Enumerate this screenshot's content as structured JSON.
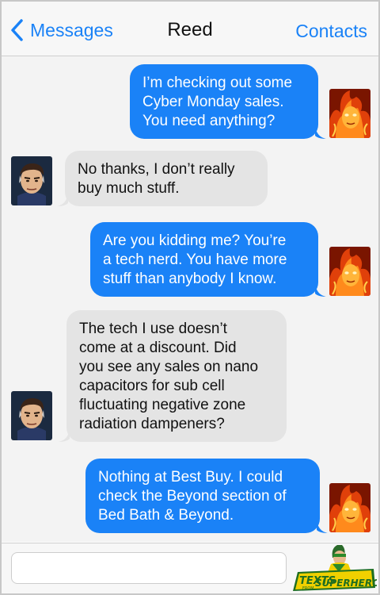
{
  "nav": {
    "back_label": "Messages",
    "title": "Reed",
    "right_label": "Contacts"
  },
  "messages": [
    {
      "sender": "me",
      "lines": [
        "I’m checking out some",
        "Cyber Monday sales.",
        "You need anything?"
      ]
    },
    {
      "sender": "Reed",
      "lines": [
        "No thanks, I don’t really",
        "buy much stuff."
      ]
    },
    {
      "sender": "me",
      "lines": [
        "Are you kidding me? You’re",
        "a tech nerd. You have more",
        "stuff than anybody I know."
      ]
    },
    {
      "sender": "Reed",
      "lines": [
        "The tech I use doesn’t",
        "come at a discount. Did",
        "you see any sales on nano",
        "capacitors for sub cell",
        "fluctuating negative zone",
        "radiation dampeners?"
      ]
    },
    {
      "sender": "me",
      "lines": [
        "Nothing at Best Buy. I could",
        "check the Beyond section of",
        "Bed Bath & Beyond."
      ]
    }
  ],
  "input": {
    "placeholder": ""
  },
  "logo": {
    "line1": "TEXTS",
    "line2": "FROM",
    "line3": "SUPERHEROES"
  },
  "colors": {
    "outgoing_bubble": "#1a82f7",
    "incoming_bubble": "#e4e4e4",
    "accent": "#1a82f7",
    "thread_background": "#f3f3f3"
  }
}
